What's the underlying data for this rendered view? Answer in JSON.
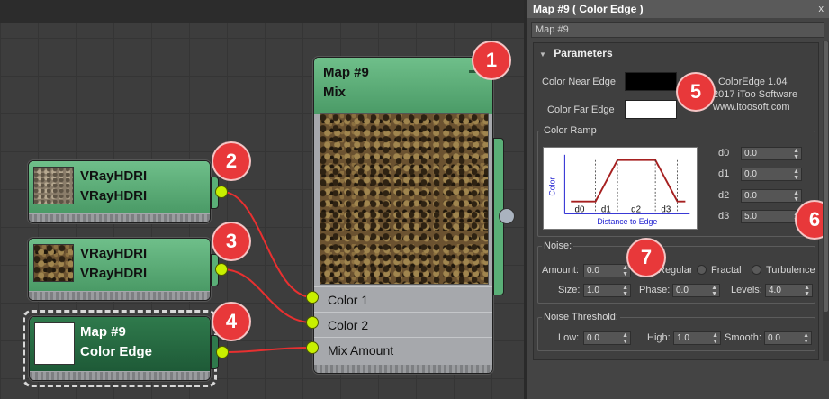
{
  "nodes": {
    "mix": {
      "title": "Map #9",
      "subtitle": "Mix",
      "ports": [
        "Color 1",
        "Color 2",
        "Mix Amount"
      ]
    },
    "vray1": {
      "title": "VRayHDRI",
      "subtitle": "VRayHDRI"
    },
    "vray2": {
      "title": "VRayHDRI",
      "subtitle": "VRayHDRI"
    },
    "coloredge": {
      "title": "Map #9",
      "subtitle": "Color Edge"
    }
  },
  "badges": [
    "1",
    "2",
    "3",
    "4",
    "5",
    "6",
    "7"
  ],
  "panel": {
    "title": "Map #9  ( Color Edge )",
    "close_icon": "x",
    "name_value": "Map #9",
    "rollout_title": "Parameters",
    "color_near_label": "Color Near Edge",
    "color_far_label": "Color Far Edge",
    "color_near": "#000000",
    "color_far": "#ffffff",
    "about": [
      "ColorEdge 1.04",
      "2017 iToo Software",
      "www.itoosoft.com"
    ],
    "color_ramp": {
      "label": "Color Ramp",
      "y_axis": "Color",
      "x_axis": "Distance to Edge",
      "segments": [
        "d0",
        "d1",
        "d2",
        "d3"
      ]
    },
    "distances": [
      {
        "label": "d0",
        "value": "0.0"
      },
      {
        "label": "d1",
        "value": "0.0"
      },
      {
        "label": "d2",
        "value": "0.0"
      },
      {
        "label": "d3",
        "value": "5.0"
      }
    ],
    "noise": {
      "label": "Noise:",
      "amount_label": "Amount:",
      "amount": "0.0",
      "types": [
        "Regular",
        "Fractal",
        "Turbulence"
      ],
      "size_label": "Size:",
      "size": "1.0",
      "phase_label": "Phase:",
      "phase": "0.0",
      "levels_label": "Levels:",
      "levels": "4.0"
    },
    "threshold": {
      "label": "Noise Threshold:",
      "low_label": "Low:",
      "low": "0.0",
      "high_label": "High:",
      "high": "1.0",
      "smooth_label": "Smooth:",
      "smooth": "0.0"
    }
  }
}
